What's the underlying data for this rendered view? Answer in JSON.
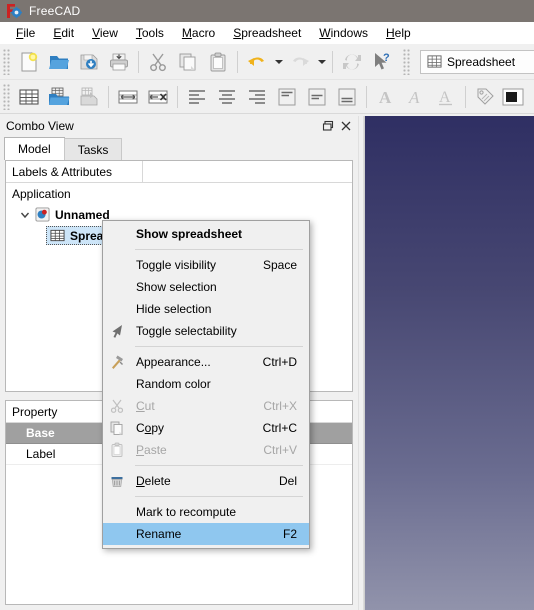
{
  "window": {
    "title": "FreeCAD",
    "app_icon": "freecad-logo-icon"
  },
  "menubar": {
    "items": [
      {
        "label": "File",
        "mnemonic": "F",
        "rest": "ile"
      },
      {
        "label": "Edit",
        "mnemonic": "E",
        "rest": "dit"
      },
      {
        "label": "View",
        "mnemonic": "V",
        "rest": "iew"
      },
      {
        "label": "Tools",
        "mnemonic": "T",
        "rest": "ools"
      },
      {
        "label": "Macro",
        "mnemonic": "M",
        "rest": "acro"
      },
      {
        "label": "Spreadsheet",
        "mnemonic": "S",
        "rest": "preadsheet"
      },
      {
        "label": "Windows",
        "mnemonic": "W",
        "rest": "indows"
      },
      {
        "label": "Help",
        "mnemonic": "H",
        "rest": "elp"
      }
    ]
  },
  "toolbar_file": {
    "buttons": [
      {
        "name": "new-document-button",
        "icon": "new-file-icon"
      },
      {
        "name": "open-document-button",
        "icon": "open-folder-icon"
      },
      {
        "name": "save-document-button",
        "icon": "save-icon"
      },
      {
        "name": "print-button",
        "icon": "printer-icon"
      },
      {
        "name": "cut-button",
        "icon": "scissors-icon"
      },
      {
        "name": "copy-button",
        "icon": "copy-icon"
      },
      {
        "name": "paste-button",
        "icon": "clipboard-paste-icon"
      },
      {
        "name": "undo-button",
        "icon": "undo-arrow-icon"
      },
      {
        "name": "redo-button",
        "icon": "redo-arrow-icon"
      },
      {
        "name": "refresh-button",
        "icon": "refresh-icon"
      },
      {
        "name": "whats-this-button",
        "icon": "whats-this-cursor-icon"
      }
    ],
    "workbench_selector": {
      "value": "Spreadsheet",
      "icon": "spreadsheet-grid-icon"
    }
  },
  "toolbar_spreadsheet": {
    "buttons": [
      {
        "name": "create-spreadsheet-button",
        "icon": "spreadsheet-grid-icon"
      },
      {
        "name": "import-spreadsheet-button",
        "icon": "import-folder-icon"
      },
      {
        "name": "export-spreadsheet-button",
        "icon": "export-icon"
      },
      {
        "name": "merge-cells-button",
        "icon": "merge-cells-icon"
      },
      {
        "name": "split-cell-button",
        "icon": "split-cell-icon"
      },
      {
        "name": "align-left-button",
        "icon": "align-left-icon"
      },
      {
        "name": "align-center-button",
        "icon": "align-center-icon"
      },
      {
        "name": "align-right-button",
        "icon": "align-right-icon"
      },
      {
        "name": "align-top-button",
        "icon": "align-top-icon"
      },
      {
        "name": "align-vcenter-button",
        "icon": "align-vcenter-icon"
      },
      {
        "name": "align-bottom-button",
        "icon": "align-bottom-icon"
      },
      {
        "name": "style-bold-button",
        "icon": "bold-a-icon"
      },
      {
        "name": "style-italic-button",
        "icon": "italic-a-icon"
      },
      {
        "name": "style-underline-button",
        "icon": "underline-a-icon"
      },
      {
        "name": "set-alias-button",
        "icon": "alias-tag-icon"
      },
      {
        "name": "cell-color-button",
        "icon": "color-swatch-icon"
      }
    ]
  },
  "combo_view": {
    "title": "Combo View",
    "float_button_icon": "float-window-icon",
    "close_button_icon": "close-icon",
    "tabs": [
      {
        "label": "Model",
        "active": true
      },
      {
        "label": "Tasks",
        "active": false
      }
    ]
  },
  "tree": {
    "header": {
      "col1": "Labels & Attributes",
      "col2": ""
    },
    "rows": [
      {
        "label": "Application",
        "level": 0,
        "bold": false,
        "expanded": null,
        "icon": null,
        "selected": false
      },
      {
        "label": "Unnamed",
        "level": 1,
        "bold": true,
        "expanded": true,
        "icon": "freecad-document-icon",
        "selected": false
      },
      {
        "label": "Spreadsheet",
        "level": 2,
        "bold": true,
        "expanded": null,
        "icon": "spreadsheet-grid-icon",
        "selected": true
      }
    ]
  },
  "property_editor": {
    "header": {
      "col1": "Property",
      "col2": ""
    },
    "rows": [
      {
        "name": "Base",
        "value": "",
        "group": true
      },
      {
        "name": "Label",
        "value": "",
        "group": false
      }
    ]
  },
  "context_menu": {
    "items": [
      {
        "id": "show-spreadsheet",
        "label": "Show spreadsheet",
        "shortcut": "",
        "icon": null,
        "bold": true,
        "disabled": false,
        "highlighted": false
      },
      {
        "id": "separator-1",
        "separator": true
      },
      {
        "id": "toggle-visibility",
        "label": "Toggle visibility",
        "shortcut": "Space",
        "icon": null,
        "bold": false,
        "disabled": false,
        "highlighted": false
      },
      {
        "id": "show-selection",
        "label": "Show selection",
        "shortcut": "",
        "icon": null,
        "bold": false,
        "disabled": false,
        "highlighted": false
      },
      {
        "id": "hide-selection",
        "label": "Hide selection",
        "shortcut": "",
        "icon": null,
        "bold": false,
        "disabled": false,
        "highlighted": false
      },
      {
        "id": "toggle-selectability",
        "label": "Toggle selectability",
        "shortcut": "",
        "icon": "arrow-cursor-icon",
        "bold": false,
        "disabled": false,
        "highlighted": false
      },
      {
        "id": "separator-2",
        "separator": true
      },
      {
        "id": "appearance",
        "label": "Appearance...",
        "shortcut": "Ctrl+D",
        "icon": "appearance-hammer-icon",
        "bold": false,
        "disabled": false,
        "highlighted": false
      },
      {
        "id": "random-color",
        "label": "Random color",
        "shortcut": "",
        "icon": null,
        "bold": false,
        "disabled": false,
        "highlighted": false
      },
      {
        "id": "cut",
        "label": "Cut",
        "mnemonic": "C",
        "rest": "ut",
        "shortcut": "Ctrl+X",
        "icon": "scissors-icon",
        "bold": false,
        "disabled": true,
        "highlighted": false
      },
      {
        "id": "copy",
        "label": "Copy",
        "shortcut": "Ctrl+C",
        "icon": "copy-icon",
        "bold": false,
        "disabled": false,
        "highlighted": false
      },
      {
        "id": "paste",
        "label": "Paste",
        "mnemonic": "P",
        "rest": "aste",
        "shortcut": "Ctrl+V",
        "icon": "clipboard-paste-icon",
        "bold": false,
        "disabled": true,
        "highlighted": false
      },
      {
        "id": "separator-3",
        "separator": true
      },
      {
        "id": "delete",
        "label": "Delete",
        "mnemonic": "D",
        "rest": "elete",
        "shortcut": "Del",
        "icon": "delete-bin-icon",
        "bold": false,
        "disabled": false,
        "highlighted": false
      },
      {
        "id": "separator-4",
        "separator": true
      },
      {
        "id": "mark-to-recompute",
        "label": "Mark to recompute",
        "shortcut": "",
        "icon": null,
        "bold": false,
        "disabled": false,
        "highlighted": false
      },
      {
        "id": "rename",
        "label": "Rename",
        "shortcut": "F2",
        "icon": null,
        "bold": false,
        "disabled": false,
        "highlighted": true
      }
    ]
  },
  "colors": {
    "titlebar_bg": "#7b7571",
    "menu_highlight": "#8fc7ef",
    "property_group_bg": "#a0a0a0",
    "tree_selection": "#cde5f8",
    "view3d_top": "#2f2f63",
    "view3d_bottom": "#9193ab"
  }
}
